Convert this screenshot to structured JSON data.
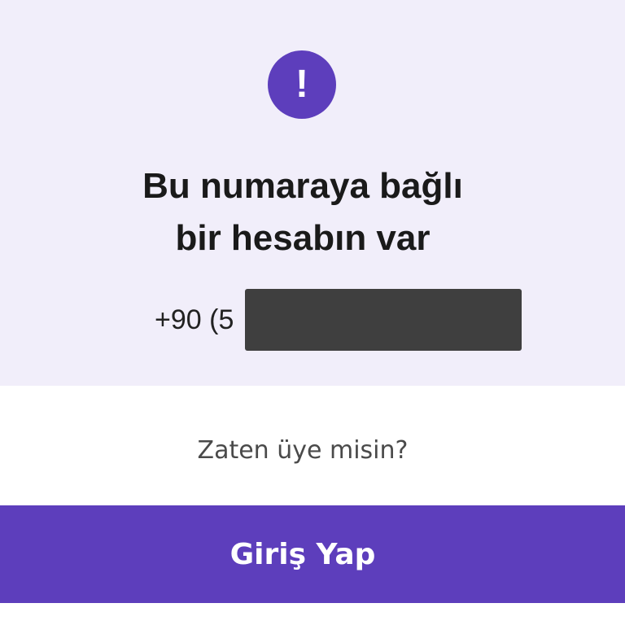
{
  "colors": {
    "accent": "#5d3ebc",
    "panel_background": "#f1eefa",
    "text_primary": "#1a1a1a",
    "text_secondary": "#4a4a4a",
    "redaction": "#3f3f3f"
  },
  "alert": {
    "icon": "exclamation-icon",
    "glyph": "!"
  },
  "title": {
    "line1": "Bu numaraya bağlı",
    "line2": "bir hesabın var"
  },
  "phone": {
    "prefix": "+90 (5",
    "redacted": true
  },
  "prompt": {
    "question": "Zaten üye misin?"
  },
  "actions": {
    "login_label": "Giriş Yap"
  }
}
